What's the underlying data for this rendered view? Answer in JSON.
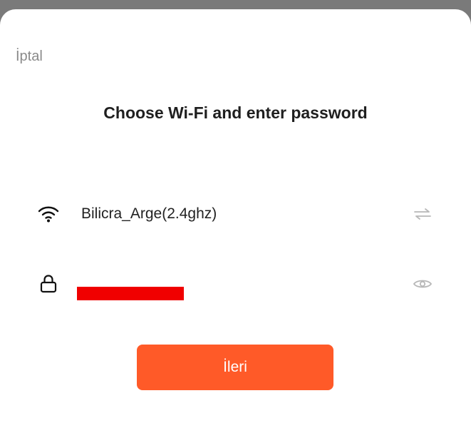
{
  "header": {
    "cancel_label": "İptal",
    "title": "Choose Wi-Fi and enter password"
  },
  "wifi": {
    "icon": "wifi-icon",
    "ssid": "Bilicra_Arge(2.4ghz)",
    "switch_icon": "switch-network-icon"
  },
  "password": {
    "icon": "lock-icon",
    "value_redacted": true,
    "visibility_icon": "eye-icon"
  },
  "actions": {
    "next_label": "İleri"
  },
  "colors": {
    "accent": "#ff5a28",
    "redaction": "#f00000",
    "title_text": "#1f1f1f",
    "muted_text": "#8a8a8a",
    "icon_muted": "#b8b8b8"
  }
}
